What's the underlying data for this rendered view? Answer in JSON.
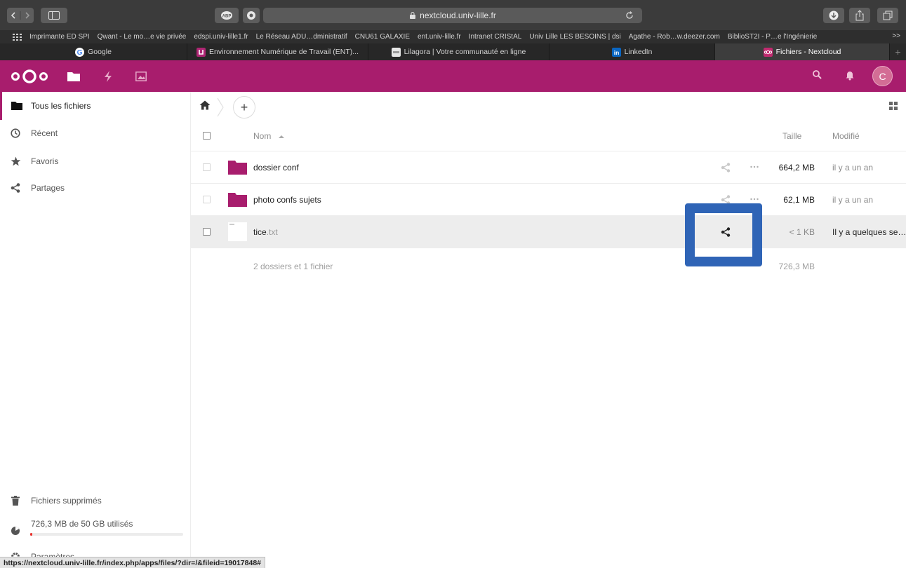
{
  "browser": {
    "url": "nextcloud.univ-lille.fr",
    "bookmarks": [
      "Imprimante ED SPI",
      "Qwant - Le mo…e vie privée",
      "edspi.univ-lille1.fr",
      "Le Réseau ADU…dministratif",
      "CNU61 GALAXIE",
      "ent.univ-lille.fr",
      "Intranet CRIStAL",
      "Univ Lille LES BESOINS | dsi",
      "Agathe - Rob…w.deezer.com",
      "BiblioST2I - P…e l'Ingénierie"
    ],
    "bookmarks_more": ">>",
    "tabs": [
      {
        "label": "Google",
        "icon": "google-icon"
      },
      {
        "label": "Environnement Numérique de Travail (ENT)...",
        "icon": "ent-icon"
      },
      {
        "label": "Lilagora | Votre communauté en ligne",
        "icon": "lilagora-icon"
      },
      {
        "label": "LinkedIn",
        "icon": "linkedin-icon"
      },
      {
        "label": "Fichiers - Nextcloud",
        "icon": "nextcloud-icon",
        "active": true
      }
    ],
    "status_url": "https://nextcloud.univ-lille.fr/index.php/apps/files/?dir=/&fileid=19017848#"
  },
  "header": {
    "avatar_letter": "C",
    "brand_color": "#a81d6d"
  },
  "sidebar": {
    "items": [
      {
        "label": "Tous les fichiers",
        "icon": "folder-icon",
        "active": true
      },
      {
        "label": "Récent",
        "icon": "clock-icon"
      },
      {
        "label": "Favoris",
        "icon": "star-icon"
      },
      {
        "label": "Partages",
        "icon": "share-icon"
      }
    ],
    "deleted": "Fichiers supprimés",
    "quota": "726,3 MB de 50 GB utilisés",
    "quota_fraction": 0.0145,
    "settings": "Paramètres"
  },
  "files": {
    "columns": {
      "name": "Nom",
      "size": "Taille",
      "modified": "Modifié"
    },
    "rows": [
      {
        "name": "dossier conf",
        "ext": "",
        "type": "folder",
        "size": "664,2 MB",
        "modified": "il y a un an"
      },
      {
        "name": "photo confs sujets",
        "ext": "",
        "type": "folder",
        "size": "62,1 MB",
        "modified": "il y a un an"
      },
      {
        "name": "tice",
        "ext": ".txt",
        "type": "file",
        "size": "< 1 KB",
        "modified": "Il y a quelques se…"
      }
    ],
    "summary": "2 dossiers et 1 fichier",
    "total_size": "726,3 MB"
  }
}
